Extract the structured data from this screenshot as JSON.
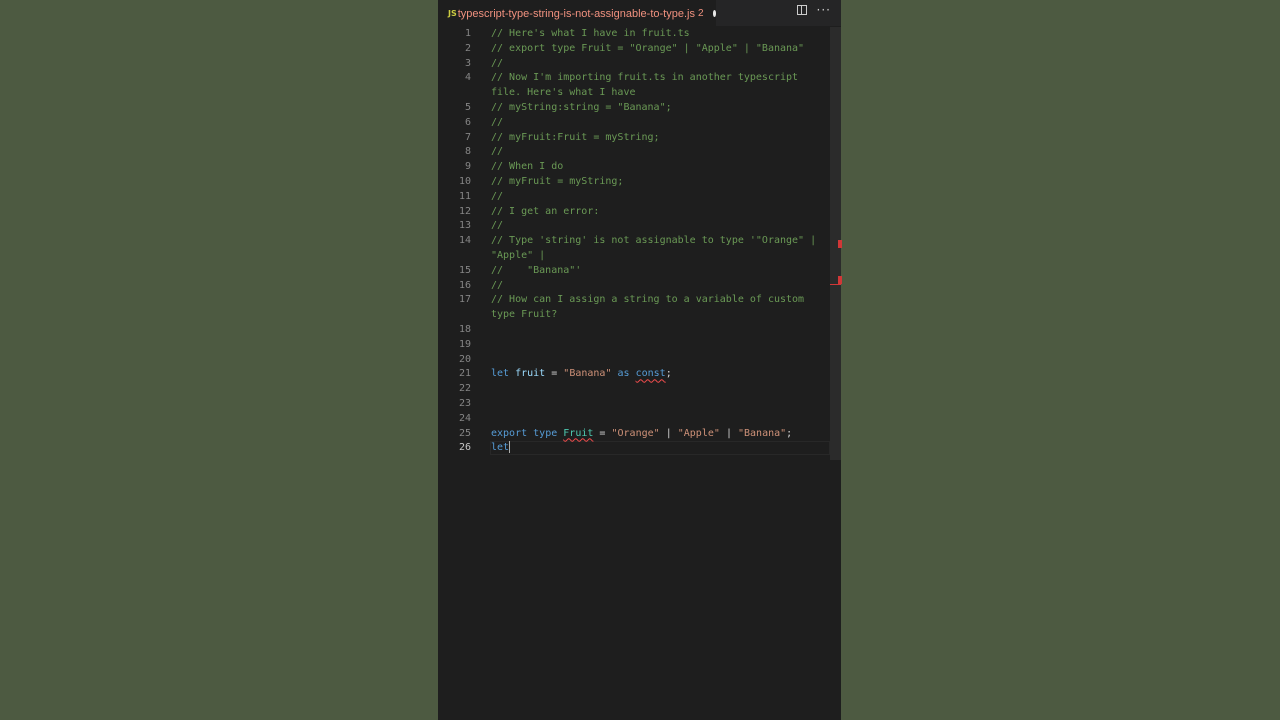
{
  "tab": {
    "icon": "JS",
    "filename": "typescript-type-string-is-not-assignable-to-type.js",
    "problem_count": "2",
    "dirty": true
  },
  "icons": {
    "split": "split-editor-icon",
    "more": "more-actions-icon",
    "more_glyph": "···"
  },
  "colors": {
    "background": "#4d5a41",
    "editor": "#1e1e1e",
    "comment": "#6a9955",
    "keyword": "#569cd6",
    "string": "#ce9178",
    "error": "#f14c4c"
  },
  "lines": [
    {
      "n": "1",
      "text": "// Here's what I have in fruit.ts"
    },
    {
      "n": "2",
      "text": "// export type Fruit = \"Orange\" | \"Apple\" | \"Banana\""
    },
    {
      "n": "3",
      "text": "//"
    },
    {
      "n": "4",
      "text": "// Now I'm importing fruit.ts in another typescript"
    },
    {
      "n": "",
      "text": "file. Here's what I have"
    },
    {
      "n": "5",
      "text": "// myString:string = \"Banana\";"
    },
    {
      "n": "6",
      "text": "//"
    },
    {
      "n": "7",
      "text": "// myFruit:Fruit = myString;"
    },
    {
      "n": "8",
      "text": "//"
    },
    {
      "n": "9",
      "text": "// When I do"
    },
    {
      "n": "10",
      "text": "// myFruit = myString;"
    },
    {
      "n": "11",
      "text": "//"
    },
    {
      "n": "12",
      "text": "// I get an error:"
    },
    {
      "n": "13",
      "text": "//"
    },
    {
      "n": "14",
      "text": "// Type 'string' is not assignable to type '\"Orange\" |"
    },
    {
      "n": "",
      "text": "\"Apple\" |"
    },
    {
      "n": "15",
      "text": "//    \"Banana\"'"
    },
    {
      "n": "16",
      "text": "//"
    },
    {
      "n": "17",
      "text": "// How can I assign a string to a variable of custom"
    },
    {
      "n": "",
      "text": "type Fruit?"
    },
    {
      "n": "18",
      "text": ""
    },
    {
      "n": "19",
      "text": ""
    },
    {
      "n": "20",
      "text": ""
    },
    {
      "n": "21",
      "text": "",
      "tokens": [
        "let",
        "fruit",
        "=",
        "\"Banana\"",
        "as",
        "const",
        ";"
      ]
    },
    {
      "n": "22",
      "text": ""
    },
    {
      "n": "23",
      "text": ""
    },
    {
      "n": "24",
      "text": ""
    },
    {
      "n": "25",
      "text": "",
      "tokens": [
        "export",
        "type",
        "Fruit",
        "=",
        "\"Orange\"",
        "|",
        "\"Apple\"",
        "|",
        "\"Banana\"",
        ";"
      ]
    },
    {
      "n": "26",
      "text": "",
      "tokens": [
        "let"
      ]
    }
  ]
}
